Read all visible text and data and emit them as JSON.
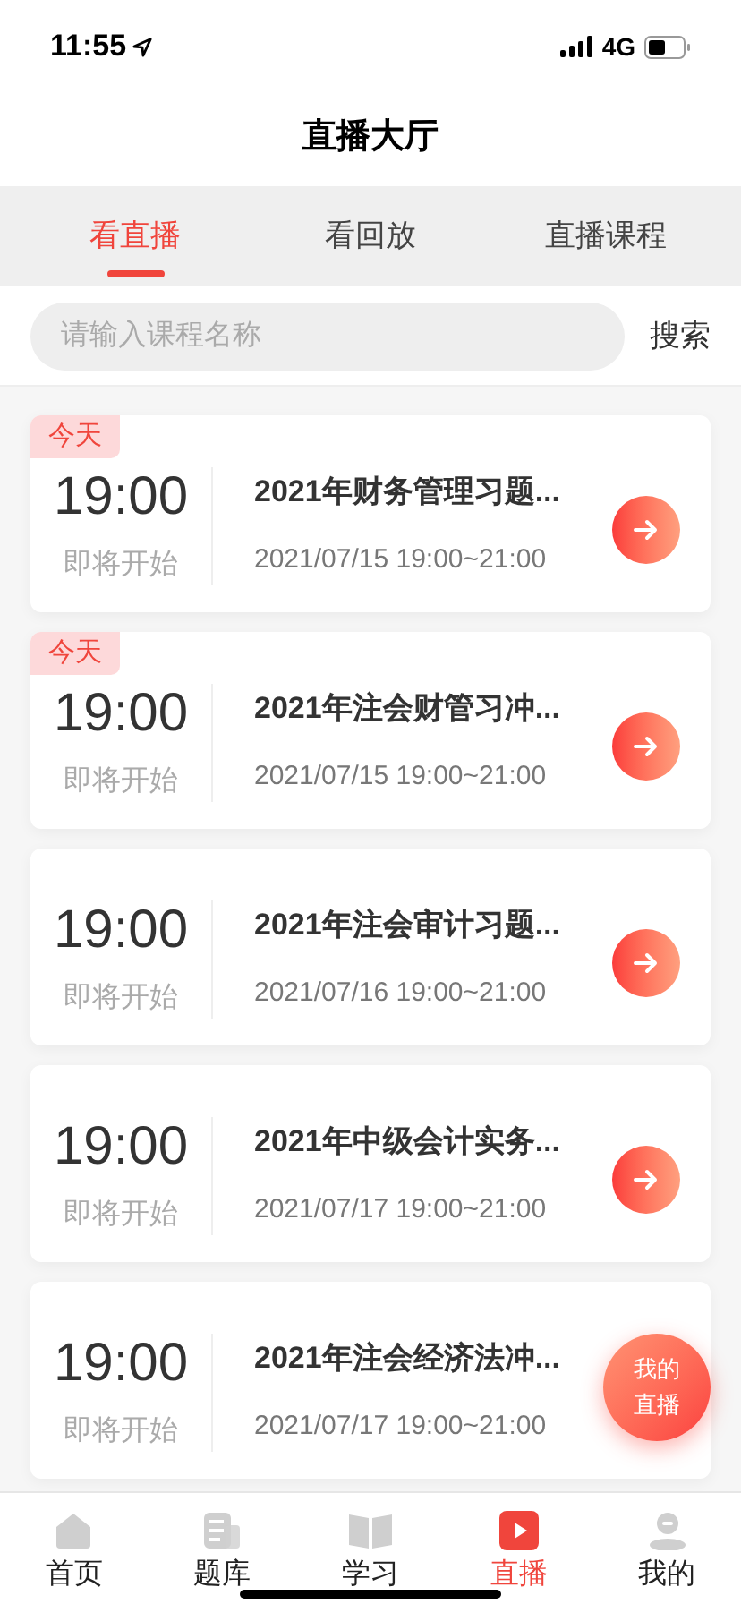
{
  "status_bar": {
    "time": "11:55",
    "network": "4G"
  },
  "header": {
    "title": "直播大厅"
  },
  "tabs": [
    {
      "label": "看直播",
      "selected": true
    },
    {
      "label": "看回放",
      "selected": false
    },
    {
      "label": "直播课程",
      "selected": false
    }
  ],
  "search": {
    "placeholder": "请输入课程名称",
    "button": "搜索"
  },
  "sessions": [
    {
      "badge": "今天",
      "time": "19:00",
      "status": "即将开始",
      "title": "2021年财务管理习题...",
      "schedule": "2021/07/15 19:00~21:00",
      "arrow": true
    },
    {
      "badge": "今天",
      "time": "19:00",
      "status": "即将开始",
      "title": "2021年注会财管习冲...",
      "schedule": "2021/07/15 19:00~21:00",
      "arrow": true
    },
    {
      "time": "19:00",
      "status": "即将开始",
      "title": "2021年注会审计习题...",
      "schedule": "2021/07/16 19:00~21:00",
      "arrow": true
    },
    {
      "time": "19:00",
      "status": "即将开始",
      "title": "2021年中级会计实务...",
      "schedule": "2021/07/17 19:00~21:00",
      "arrow": true
    },
    {
      "time": "19:00",
      "status": "即将开始",
      "title": "2021年注会经济法冲...",
      "schedule": "2021/07/17 19:00~21:00",
      "arrow": false
    }
  ],
  "floating_button": {
    "line_1": "我的",
    "line_2": "直播"
  },
  "bottom_nav": [
    {
      "kind": "home",
      "label": "首页",
      "selected": false
    },
    {
      "kind": "questions",
      "label": "题库",
      "selected": false
    },
    {
      "kind": "study",
      "label": "学习",
      "selected": false
    },
    {
      "kind": "live",
      "label": "直播",
      "selected": true
    },
    {
      "kind": "profile",
      "label": "我的",
      "selected": false
    }
  ]
}
